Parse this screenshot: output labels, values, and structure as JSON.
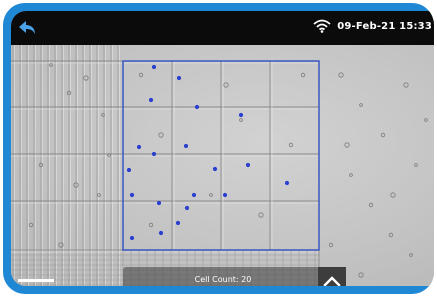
{
  "statusbar": {
    "datetime": "09-Feb-21  15:33"
  },
  "analysis": {
    "cell_count_text": "Cell Count: 20"
  },
  "colors": {
    "device_frame": "#1e88d4",
    "statusbar_bg": "#0b0b0b",
    "count_overlay_rect": "#3050c0",
    "marked_cell": "#2b3fd0"
  },
  "icons": {
    "back": "back-arrow-icon",
    "wifi": "wifi-icon",
    "expand": "chevron-up-icon"
  }
}
